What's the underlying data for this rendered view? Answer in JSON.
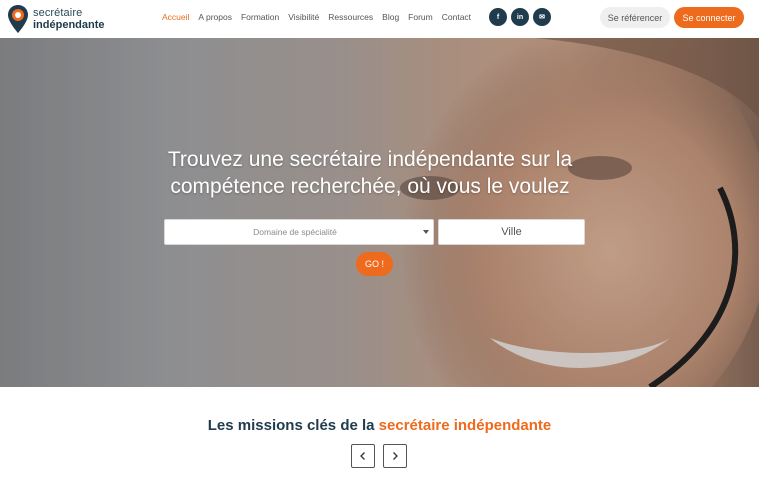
{
  "brand": {
    "line1": "secrétaire",
    "line2": "indépendante"
  },
  "nav": {
    "items": [
      {
        "label": "Accueil",
        "active": true
      },
      {
        "label": "A propos",
        "active": false
      },
      {
        "label": "Formation",
        "active": false
      },
      {
        "label": "Visibilité",
        "active": false
      },
      {
        "label": "Ressources",
        "active": false
      },
      {
        "label": "Blog",
        "active": false
      },
      {
        "label": "Forum",
        "active": false
      },
      {
        "label": "Contact",
        "active": false
      }
    ],
    "social": [
      {
        "icon": "facebook-icon",
        "glyph": "f"
      },
      {
        "icon": "linkedin-icon",
        "glyph": "in"
      },
      {
        "icon": "email-icon",
        "glyph": "✉"
      }
    ],
    "register_label": "Se référencer",
    "login_label": "Se connecter"
  },
  "hero": {
    "title": "Trouvez une secrétaire indépendante sur la compétence recherchée, où vous le voulez",
    "specialty_placeholder": "Domaine de spécialité",
    "city_placeholder": "Ville",
    "go_label": "GO !"
  },
  "missions": {
    "title_prefix": "Les missions clés de la ",
    "title_accent": "secrétaire indépendante"
  },
  "colors": {
    "accent": "#ee6a1c",
    "navy": "#1f3b4d"
  }
}
